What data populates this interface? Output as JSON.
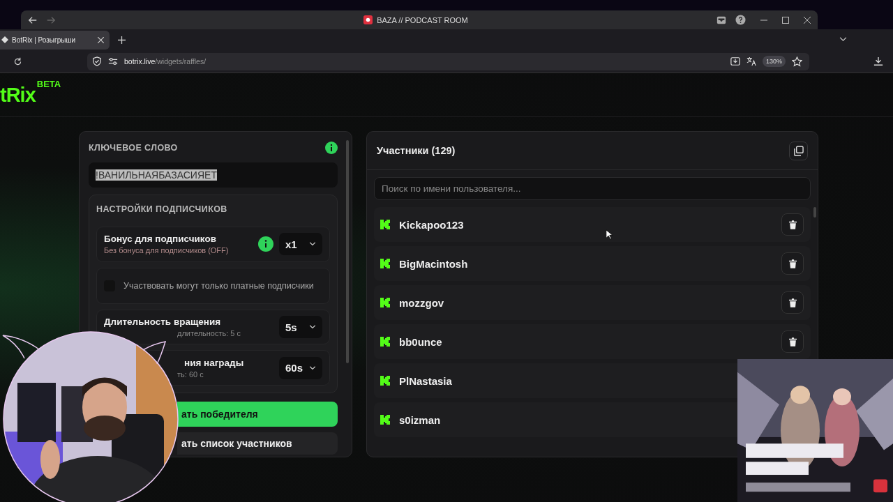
{
  "window": {
    "title": "BAZA // PODCAST ROOM"
  },
  "browser": {
    "tabs": [
      {
        "label": "BotRix | Розыгрыши",
        "selected": true
      }
    ],
    "url_host": "botrix.live",
    "url_path": "/widgets/raffles/",
    "zoom": "130%"
  },
  "logo": {
    "text": "tRix",
    "badge": "BETA"
  },
  "keyword": {
    "label": "КЛЮЧЕВОЕ СЛОВО",
    "value": "!ВАНИЛЬНАЯБАЗАСИЯЕТ",
    "selected": true
  },
  "subscriber_settings": {
    "title": "НАСТРОЙКИ ПОДПИСЧИКОВ",
    "items": [
      {
        "kind": "select",
        "title": "Бонус для подписчиков",
        "subtitle": "Без бонуса для подписчиков (OFF)",
        "value": "x1",
        "info": true,
        "warning": true,
        "title_cut": false,
        "subtitle_cut": false
      },
      {
        "kind": "checkbox",
        "label": "Участвовать могут только платные подписчики",
        "checked": false
      },
      {
        "kind": "select",
        "title": "Длительность вращения",
        "subtitle": "длительность: 5 с",
        "value": "5s",
        "info": false,
        "warning": false,
        "title_cut": false,
        "subtitle_cut": true
      },
      {
        "kind": "select",
        "title": "ния награды",
        "subtitle": "ть: 60 с",
        "value": "60s",
        "info": false,
        "warning": false,
        "title_cut": true,
        "subtitle_cut": true
      }
    ]
  },
  "actions": [
    {
      "kind": "primary",
      "label": "ать победителя"
    },
    {
      "kind": "secondary",
      "label": "ать список участников"
    }
  ],
  "participants": {
    "title": "Участники (129)",
    "search_placeholder": "Поиск по имени пользователя...",
    "rows": [
      {
        "name": "Kickapoo123",
        "delete_button": true
      },
      {
        "name": "BigMacintosh",
        "delete_button": true
      },
      {
        "name": "mozzgov",
        "delete_button": true
      },
      {
        "name": "bb0unce",
        "delete_button": true
      },
      {
        "name": "PlNastasia"
      },
      {
        "name": "s0izman"
      }
    ]
  }
}
